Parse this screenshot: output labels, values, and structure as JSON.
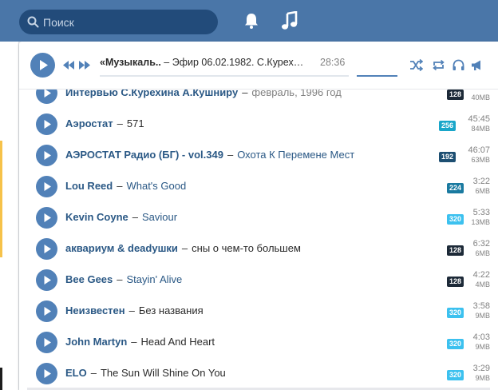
{
  "header": {
    "search_placeholder": "Поиск",
    "icons": [
      "search-icon",
      "bell-icon",
      "music-note-icon"
    ],
    "bg_color": "#4a76a8"
  },
  "player": {
    "artist": "«Музыкаль..",
    "sep": " – ",
    "title": "Эфир 06.02.1982. С.Курех…",
    "time": "28:36",
    "icons": [
      "play-icon",
      "prev-icon",
      "next-icon",
      "shuffle-icon",
      "repeat-icon",
      "headphones-icon",
      "broadcast-icon"
    ],
    "accent": "#5181b8"
  },
  "tracks": [
    {
      "artist": "Интервью С.Курехина А.Кушниру",
      "title": "февраль, 1996 год",
      "badge": "128",
      "badge_color": "#1d2a38",
      "duration": "",
      "size": "40MB"
    },
    {
      "artist": "Аэростат",
      "title": "571",
      "badge": "256",
      "badge_color": "#19a6c9",
      "duration": "45:45",
      "size": "84MB"
    },
    {
      "artist": "АЭРОСТАТ Радио (БГ) - vol.349",
      "title": "Охота К Перемене Мест",
      "badge": "192",
      "badge_color": "#1d4f72",
      "duration": "46:07",
      "size": "63MB"
    },
    {
      "artist": "Lou Reed",
      "title": "What's Good",
      "badge": "224",
      "badge_color": "#1a7aa0",
      "duration": "3:22",
      "size": "6MB"
    },
    {
      "artist": "Kevin Coyne",
      "title": "Saviour",
      "badge": "320",
      "badge_color": "#3cc1ef",
      "duration": "5:33",
      "size": "13MB"
    },
    {
      "artist": "аквариум & deadушки",
      "title": "сны о чем-то большем",
      "badge": "128",
      "badge_color": "#1d2a38",
      "duration": "6:32",
      "size": "6MB"
    },
    {
      "artist": "Bee Gees",
      "title": "Stayin' Alive",
      "badge": "128",
      "badge_color": "#1d2a38",
      "duration": "4:22",
      "size": "4MB"
    },
    {
      "artist": "Неизвестен",
      "title": "Без названия",
      "badge": "320",
      "badge_color": "#3cc1ef",
      "duration": "3:58",
      "size": "9MB"
    },
    {
      "artist": "John Martyn",
      "title": "Head And Heart",
      "badge": "320",
      "badge_color": "#3cc1ef",
      "duration": "4:03",
      "size": "9MB"
    },
    {
      "artist": "ELO",
      "title": "The Sun Will Shine On You",
      "badge": "320",
      "badge_color": "#3cc1ef",
      "duration": "3:29",
      "size": "9MB"
    }
  ]
}
